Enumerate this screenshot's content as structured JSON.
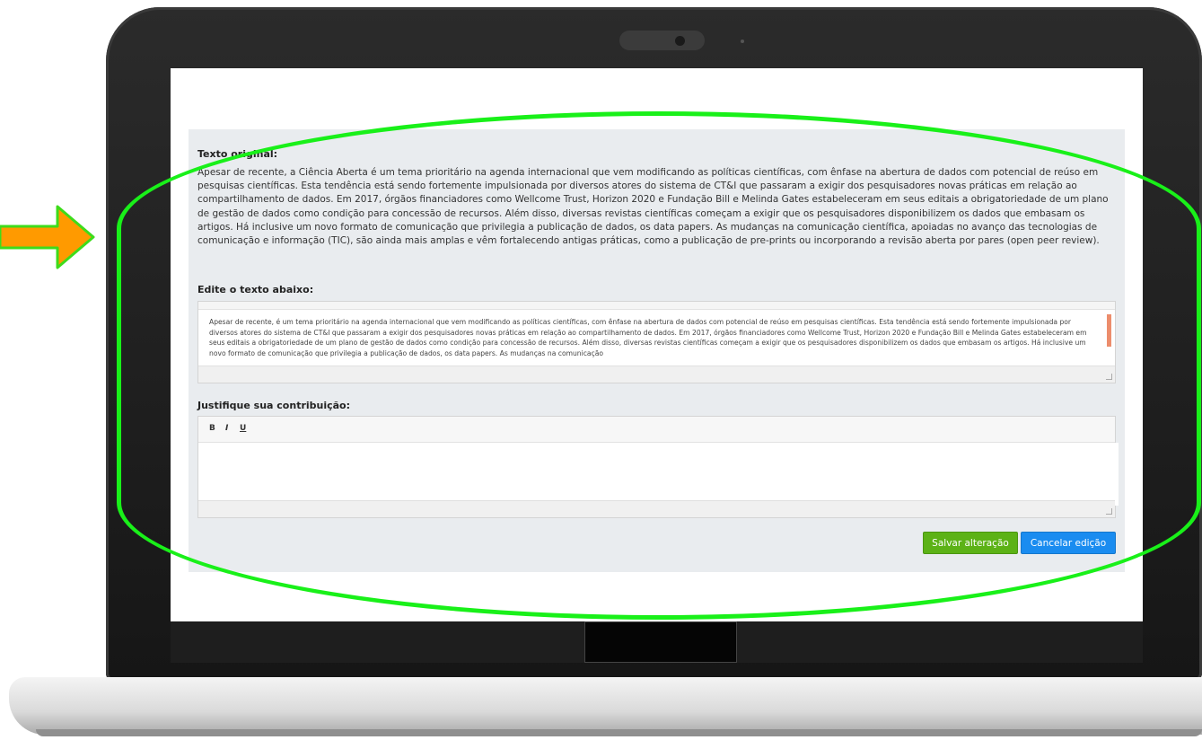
{
  "panel": {
    "original_heading": "Texto original:",
    "original_text": "Apesar de recente, a Ciência Aberta é um tema prioritário na agenda internacional que vem modificando as políticas científicas, com ênfase na abertura de dados com potencial de reúso em pesquisas científicas. Esta tendência está sendo fortemente impulsionada por diversos atores do sistema de CT&I que passaram a exigir dos pesquisadores  novas  práticas  em relação  ao  compartilhamento  de  dados. Em 2017, órgãos financiadores como Wellcome Trust, Horizon 2020 e Fundação Bill e Melinda Gates estabeleceram em seus editais a obrigatoriedade de um plano de gestão de dados como condição para concessão de recursos. Além disso, diversas revistas  científicas  começam a exigir que os pesquisadores  disponibilizem os dados que embasam os artigos. Há inclusive um novo formato de comunicação que privilegia a publicação de dados, os data papers. As mudanças na comunicação científica, apoiadas no avanço das tecnologias de comunicação e informação (TIC), são ainda mais amplas e vêm fortalecendo antigas práticas, como a publicação de pre-prints ou incorporando a revisão aberta por pares (open peer review).",
    "edit_heading": "Edite o texto abaixo:",
    "edit_text": "Apesar de recente,  é um tema prioritário na agenda internacional que vem modificando as políticas científicas, com ênfase na abertura de dados com potencial de reúso em pesquisas científicas. Esta tendência está sendo fortemente impulsionada por diversos atores do sistema de CT&I que passaram a exigir dos pesquisadores  novas  práticas  em  relação  ao  compartilhamento  de  dados.  Em 2017, órgãos financiadores como Wellcome Trust, Horizon 2020 e Fundação Bill e Melinda Gates estabeleceram em seus editais a obrigatoriedade de um plano de gestão de dados como condição para concessão de recursos. Além disso, diversas revistas  científicas começam a exigir que os pesquisadores  disponibilizem os dados que embasam os artigos. Há inclusive um novo formato de comunicação que privilegia a publicação de dados, os data papers. As mudanças na comunicação",
    "justify_heading": "Justifique sua contribuição:",
    "toolbar": {
      "bold": "B",
      "italic": "I",
      "underline": "U"
    },
    "save_label": "Salvar alteração",
    "cancel_label": "Cancelar edição"
  },
  "colors": {
    "annotation_outline": "#19f019",
    "arrow": "#ff9a00",
    "save_button": "#5cb216",
    "cancel_button": "#1a8cf0"
  }
}
